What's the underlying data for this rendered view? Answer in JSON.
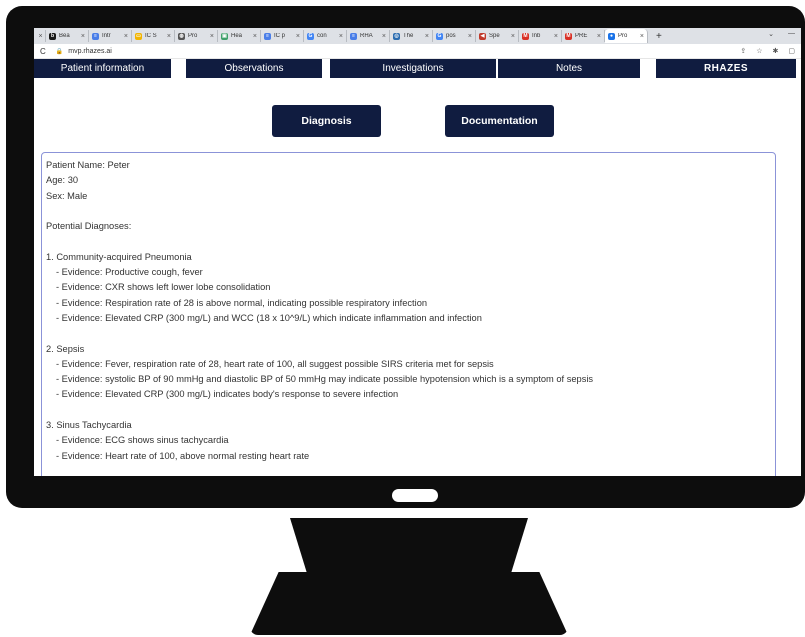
{
  "browser": {
    "tabs": [
      {
        "label": "",
        "fav": "",
        "color": "#dee1e6"
      },
      {
        "label": "Bea",
        "fav": "b",
        "color": "#1a1a1a"
      },
      {
        "label": "Intr",
        "fav": "≡",
        "color": "#4a7ee8"
      },
      {
        "label": "IC S",
        "fav": "▭",
        "color": "#f2b400"
      },
      {
        "label": "Pro",
        "fav": "◍",
        "color": "#555555"
      },
      {
        "label": "Hea",
        "fav": "▣",
        "color": "#3fa06a"
      },
      {
        "label": "IC p",
        "fav": "≡",
        "color": "#4a7ee8"
      },
      {
        "label": "con",
        "fav": "G",
        "color": "#4285f4"
      },
      {
        "label": "RHA",
        "fav": "≡",
        "color": "#4a7ee8"
      },
      {
        "label": "The",
        "fav": "◎",
        "color": "#2b6cb0"
      },
      {
        "label": "pos",
        "fav": "G",
        "color": "#4285f4"
      },
      {
        "label": "Spe",
        "fav": "◀",
        "color": "#c0392b"
      },
      {
        "label": "Inb",
        "fav": "M",
        "color": "#d93025"
      },
      {
        "label": "PRE",
        "fav": "M",
        "color": "#d93025"
      },
      {
        "label": "Pro",
        "fav": "●",
        "color": "#1a73e8",
        "active": true
      }
    ],
    "new_tab": "+",
    "controls": [
      "⌄",
      "—"
    ],
    "url": "mvp.rhazes.ai",
    "reload": "C",
    "lock": "🔒",
    "toolbar_icons": [
      "⇪",
      "☆",
      "✱",
      "▢"
    ]
  },
  "nav": {
    "patient_information": "Patient information",
    "observations": "Observations",
    "investigations": "Investigations",
    "notes": "Notes",
    "brand": "RHAZES"
  },
  "actions": {
    "diagnosis": "Diagnosis",
    "documentation": "Documentation"
  },
  "output": {
    "patient_name": "Patient Name: Peter",
    "age": "Age: 30",
    "sex": "Sex: Male",
    "heading": "Potential Diagnoses:",
    "diagnoses": [
      {
        "title": "1. Community-acquired Pneumonia",
        "evidence": [
          "- Evidence: Productive cough, fever",
          "- Evidence: CXR shows left lower lobe consolidation",
          "- Evidence: Respiration rate of 28 is above normal, indicating possible respiratory infection",
          "- Evidence: Elevated CRP (300 mg/L) and WCC (18 x 10^9/L) which indicate inflammation and infection"
        ]
      },
      {
        "title": "2. Sepsis",
        "evidence": [
          "- Evidence: Fever, respiration rate of 28, heart rate of 100, all suggest possible SIRS criteria met for sepsis",
          "- Evidence: systolic BP of 90 mmHg and diastolic BP of 50 mmHg may indicate possible hypotension which is a symptom of sepsis",
          "- Evidence: Elevated CRP (300 mg/L) indicates body's response to severe infection"
        ]
      },
      {
        "title": "3. Sinus Tachycardia",
        "evidence": [
          "- Evidence: ECG shows sinus tachycardia",
          "- Evidence: Heart rate of 100, above normal resting heart rate"
        ]
      }
    ]
  }
}
